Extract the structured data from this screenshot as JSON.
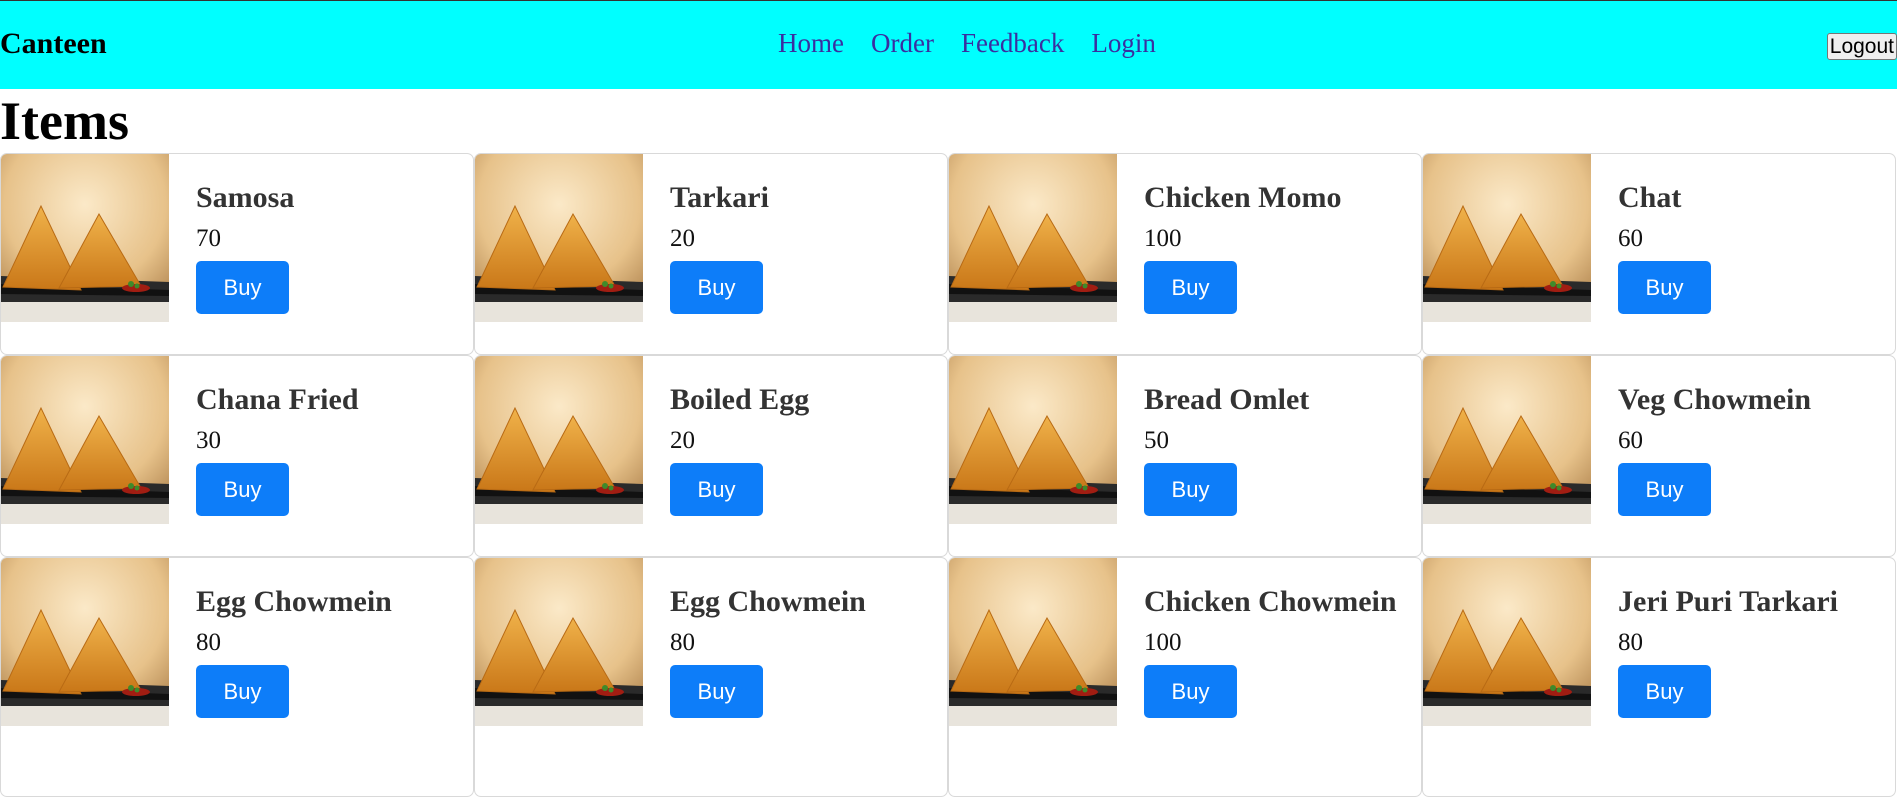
{
  "navbar": {
    "brand": "Canteen",
    "links": [
      "Home",
      "Order",
      "Feedback",
      "Login"
    ],
    "logout_label": "Logout",
    "background": "#00ffff"
  },
  "page": {
    "title": "Items"
  },
  "buy_label": "Buy",
  "accent_color": "#0d7df9",
  "items": [
    {
      "name": "Samosa",
      "price": "70"
    },
    {
      "name": "Tarkari",
      "price": "20"
    },
    {
      "name": "Chicken Momo",
      "price": "100"
    },
    {
      "name": "Chat",
      "price": "60"
    },
    {
      "name": "Chana Fried",
      "price": "30"
    },
    {
      "name": "Boiled Egg",
      "price": "20"
    },
    {
      "name": "Bread Omlet",
      "price": "50"
    },
    {
      "name": "Veg Chowmein",
      "price": "60"
    },
    {
      "name": "Egg Chowmein",
      "price": "80"
    },
    {
      "name": "Egg Chowmein",
      "price": "80"
    },
    {
      "name": "Chicken Chowmein",
      "price": "100"
    },
    {
      "name": "Jeri Puri Tarkari",
      "price": "80"
    }
  ]
}
